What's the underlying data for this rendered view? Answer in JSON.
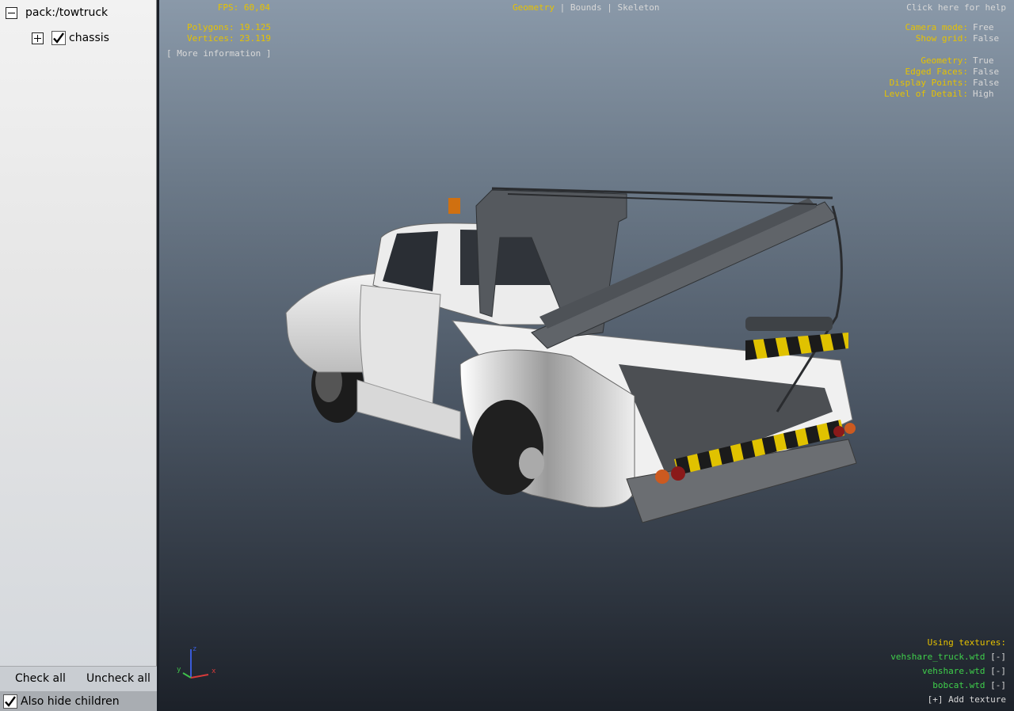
{
  "tree": {
    "root_label": "pack:/towtruck",
    "child_label": "chassis"
  },
  "panel_buttons": {
    "check_all": "Check all",
    "uncheck_all": "Uncheck all",
    "also_hide_children": "Also hide children"
  },
  "hud": {
    "fps_label": "FPS:",
    "fps_value": "60,04",
    "polygons_label": "Polygons:",
    "polygons_value": "19.125",
    "vertices_label": "Vertices:",
    "vertices_value": "23.119",
    "more_info": "[ More information ]",
    "tabs": [
      "Geometry",
      "Bounds",
      "Skeleton"
    ],
    "tab_separator": "|",
    "help": "Click here for help",
    "camera_mode_label": "Camera mode:",
    "camera_mode_value": "Free",
    "show_grid_label": "Show grid:",
    "show_grid_value": "False",
    "geometry_label": "Geometry:",
    "geometry_value": "True",
    "edged_faces_label": "Edged Faces:",
    "edged_faces_value": "False",
    "display_points_label": "Display Points:",
    "display_points_value": "False",
    "lod_label": "Level of Detail:",
    "lod_value": "High"
  },
  "textures": {
    "heading": "Using textures:",
    "items": [
      {
        "name": "vehshare_truck.wtd",
        "action": "[-]"
      },
      {
        "name": "vehshare.wtd",
        "action": "[-]"
      },
      {
        "name": "bobcat.wtd",
        "action": "[-]"
      }
    ],
    "add": "[+] Add texture"
  },
  "axis": {
    "x": "x",
    "y": "y",
    "z": "z"
  },
  "colors": {
    "hud_yellow": "#e6c200",
    "hud_white": "#d8d8d8",
    "texture_green": "#3fcf4b"
  }
}
